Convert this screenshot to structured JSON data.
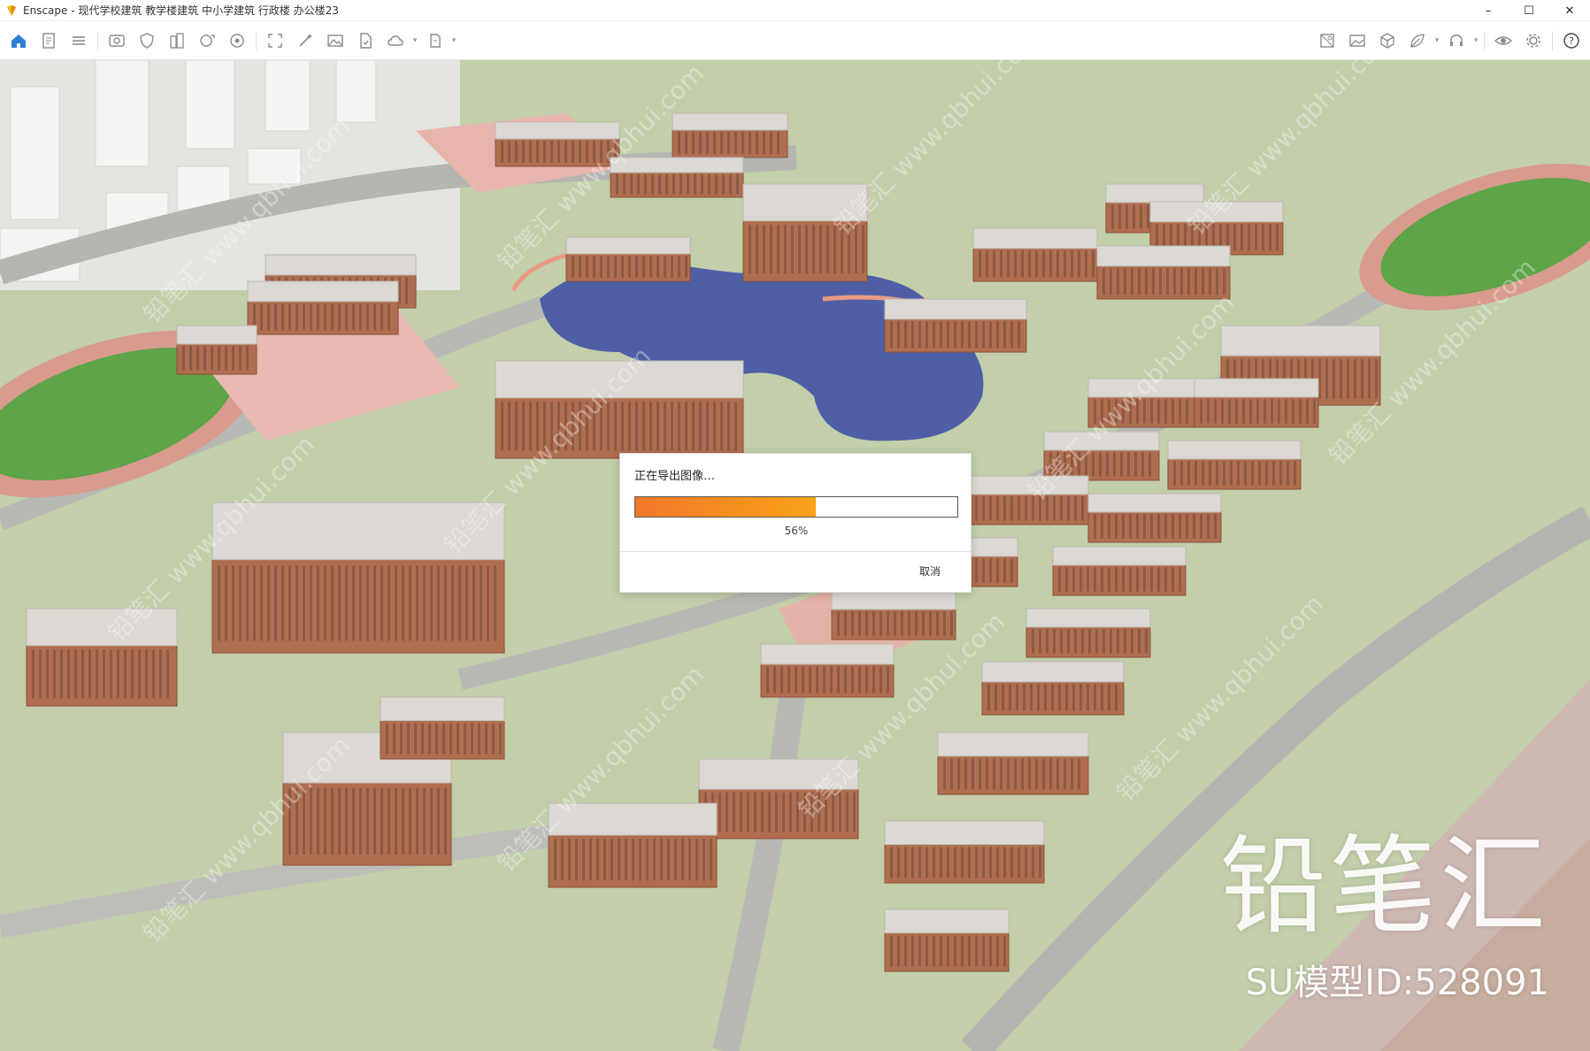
{
  "window": {
    "title": "Enscape - 现代学校建筑 教学楼建筑 中小学建筑 行政楼 办公楼23",
    "controls": [
      "–",
      "☐",
      "✕"
    ]
  },
  "toolbar": {
    "left_icons": [
      "home-icon",
      "document-icon",
      "list-icon",
      "view-icon",
      "shield-icon",
      "building-icon",
      "screenshot-icon",
      "settings-wheel-icon",
      "focus-icon",
      "magic-icon",
      "image-icon",
      "file-export-icon",
      "cloud-icon",
      "batch-icon"
    ],
    "right_icons": [
      "asset-library-icon",
      "image-gallery-icon",
      "cube-icon",
      "leaf-icon",
      "headset-icon",
      "eye-icon",
      "gear-icon",
      "help-icon"
    ]
  },
  "dialog": {
    "title": "正在导出图像…",
    "progress_percent": 56,
    "progress_label": "56%",
    "cancel_label": "取消",
    "colors": {
      "fill_start": "#f2772b",
      "fill_end": "#f9a31a"
    }
  },
  "watermark": {
    "tile_text": "铅笔汇 www.qbhui.com",
    "brand": "铅笔汇",
    "model_id": "SU模型ID:528091"
  }
}
